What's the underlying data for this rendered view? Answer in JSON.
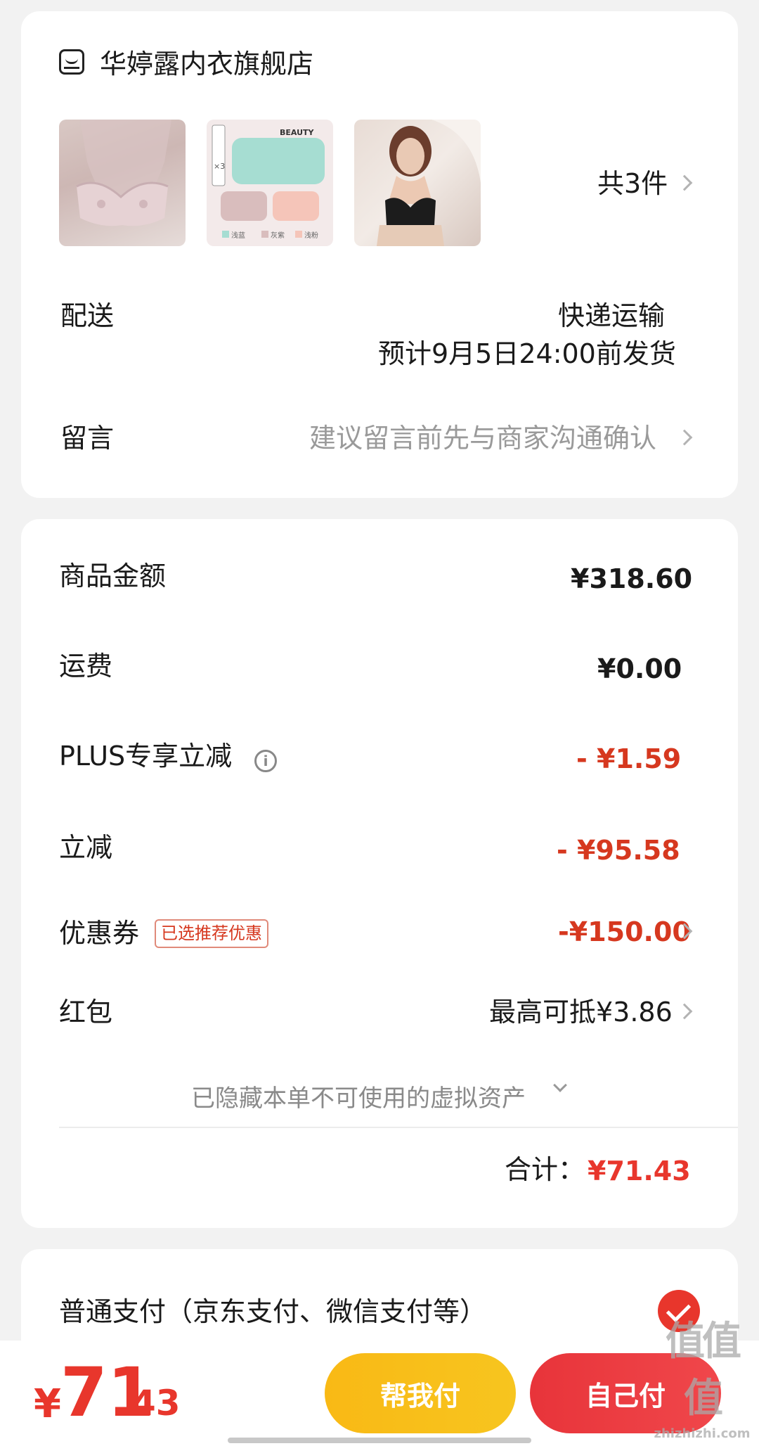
{
  "store": {
    "name": "华婷露内衣旗舰店",
    "item_count": "共3件",
    "thumbnails": [
      {
        "label": "lace-bra"
      },
      {
        "label": "panties-3pack",
        "brand": "BEAUTY",
        "pack": "×3",
        "swatches": [
          "浅蓝",
          "灰紫",
          "浅粉"
        ]
      },
      {
        "label": "black-bra"
      }
    ],
    "delivery_label": "配送",
    "delivery_method": "快递运输",
    "delivery_estimate": "预计9月5日24:00前发货",
    "message_label": "留言",
    "message_placeholder": "建议留言前先与商家沟通确认"
  },
  "amounts": {
    "goods_label": "商品金额",
    "goods_value": "¥318.60",
    "shipping_label": "运费",
    "shipping_value": "¥0.00",
    "plus_label": "PLUS专享立减",
    "plus_value": "- ¥1.59",
    "instant_label": "立减",
    "instant_value": "- ¥95.58",
    "coupon_label": "优惠券",
    "coupon_tag": "已选推荐优惠",
    "coupon_value": "-¥150.00",
    "redpacket_label": "红包",
    "redpacket_value": "最高可抵¥3.86",
    "hidden_assets": "已隐藏本单不可使用的虚拟资产",
    "total_label": "合计：",
    "total_value": "¥71.43"
  },
  "payment": {
    "option_label": "普通支付（京东支付、微信支付等）",
    "selected": true
  },
  "bottom": {
    "currency": "¥",
    "total_int": "71",
    "total_dec": ".43",
    "help_pay": "帮我付",
    "self_pay": "自己付"
  },
  "watermark": {
    "logo": "值值值",
    "url": "zhizhizhi.com"
  },
  "colors": {
    "accent_red": "#d6381f",
    "pay_red": "#e8362c",
    "help_yellow": "#f9b915"
  }
}
